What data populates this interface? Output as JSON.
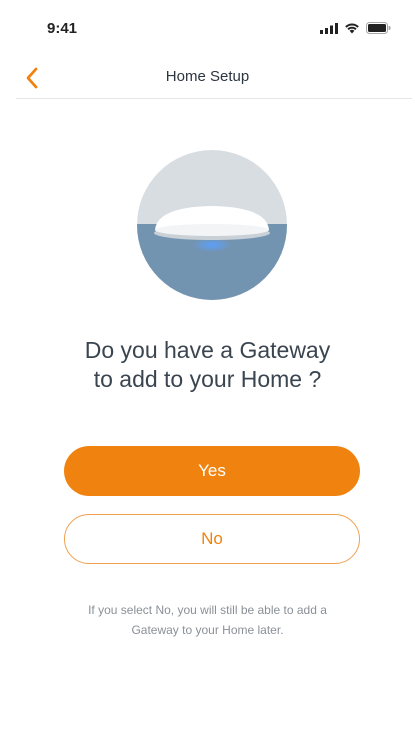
{
  "status_bar": {
    "time": "9:41"
  },
  "nav": {
    "title": "Home Setup",
    "back_icon": "chevron-left-icon"
  },
  "hero": {
    "image": "gateway-device-illustration"
  },
  "question": {
    "line1": "Do you have a Gateway",
    "line2": "to add to your Home ?"
  },
  "buttons": {
    "yes_label": "Yes",
    "no_label": "No"
  },
  "footnote": {
    "line1": "If you select No, you will still be able to add a",
    "line2": "Gateway to your Home later."
  },
  "colors": {
    "accent": "#f0830f",
    "text": "#3b4550",
    "muted": "#8a9097"
  }
}
